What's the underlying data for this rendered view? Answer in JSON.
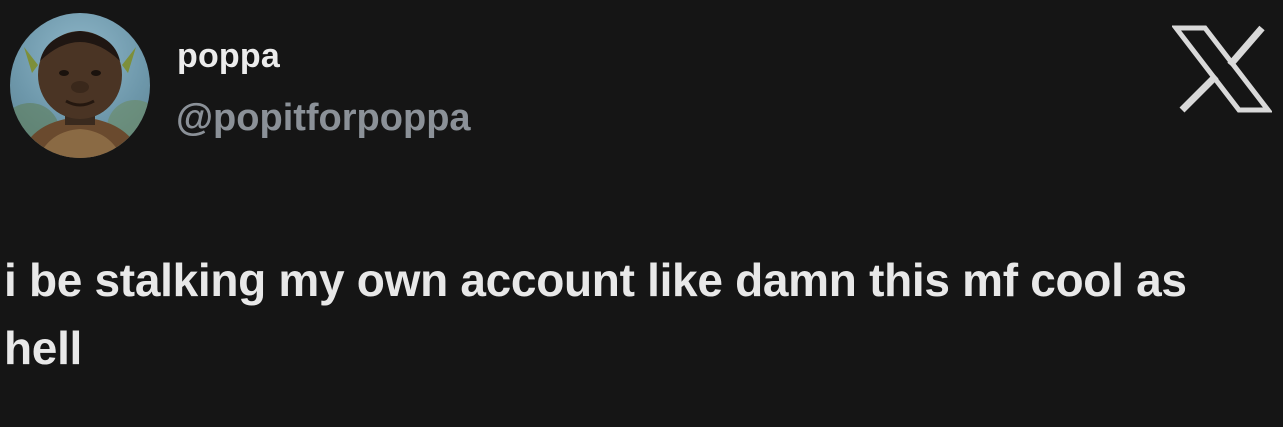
{
  "author": {
    "display_name": "poppa",
    "handle": "@popitforpoppa",
    "avatar": "ogre-character-avatar"
  },
  "brand": {
    "icon": "x-logo-icon",
    "color": "#d9d9d9"
  },
  "tweet": {
    "text": "i be stalking my own account like damn this mf cool as hell"
  },
  "colors": {
    "background": "#151515",
    "name_text": "#ececec",
    "handle_text": "#8b9198",
    "body_text": "#e8e8e8"
  }
}
